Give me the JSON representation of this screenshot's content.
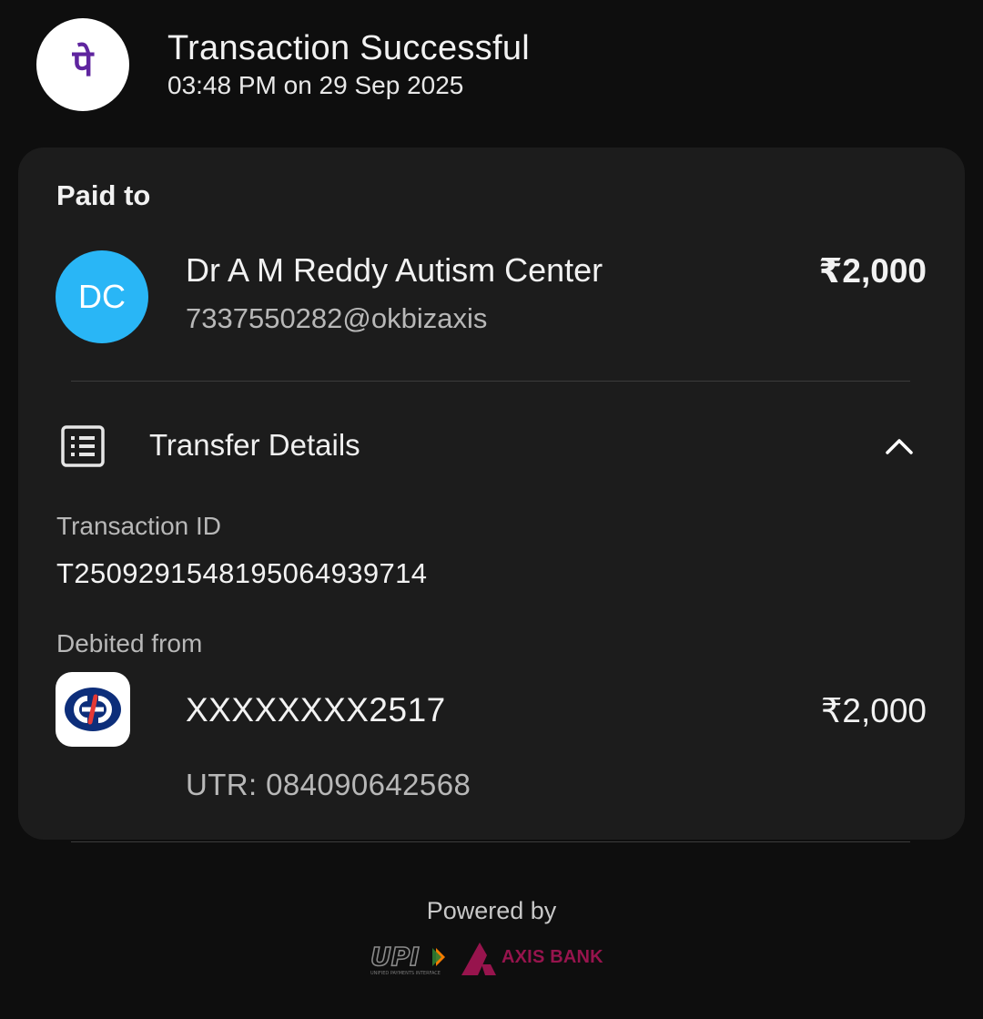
{
  "header": {
    "title": "Transaction Successful",
    "datetime": "03:48 PM on 29 Sep 2025",
    "app_logo_icon": "phonepe-logo-icon",
    "app_logo_text": "पे"
  },
  "paid_to": {
    "label": "Paid to",
    "avatar_initials": "DC",
    "avatar_color": "#29b6f6",
    "name": "Dr A M Reddy Autism Center",
    "upi_id": "7337550282@okbizaxis",
    "amount": "₹2,000"
  },
  "transfer_details": {
    "label": "Transfer Details",
    "icon": "receipt-icon",
    "toggle_icon": "chevron-up-icon",
    "transaction_id_label": "Transaction ID",
    "transaction_id": "T2509291548195064939714",
    "debited_from_label": "Debited from",
    "bank_logo_icon": "kotak-bank-logo-icon",
    "account_number": "XXXXXXXX2517",
    "debit_amount": "₹2,000",
    "utr": "UTR: 084090642568"
  },
  "footer": {
    "powered_by": "Powered by",
    "upi_logo_text": "UPI",
    "upi_tagline": "UNIFIED PAYMENTS INTERFACE",
    "bank_partner": "AXIS BANK",
    "brand_color": "#97144d"
  },
  "colors": {
    "background": "#0e0e0e",
    "card": "#1c1c1c",
    "phonepe_purple": "#5f259f"
  }
}
